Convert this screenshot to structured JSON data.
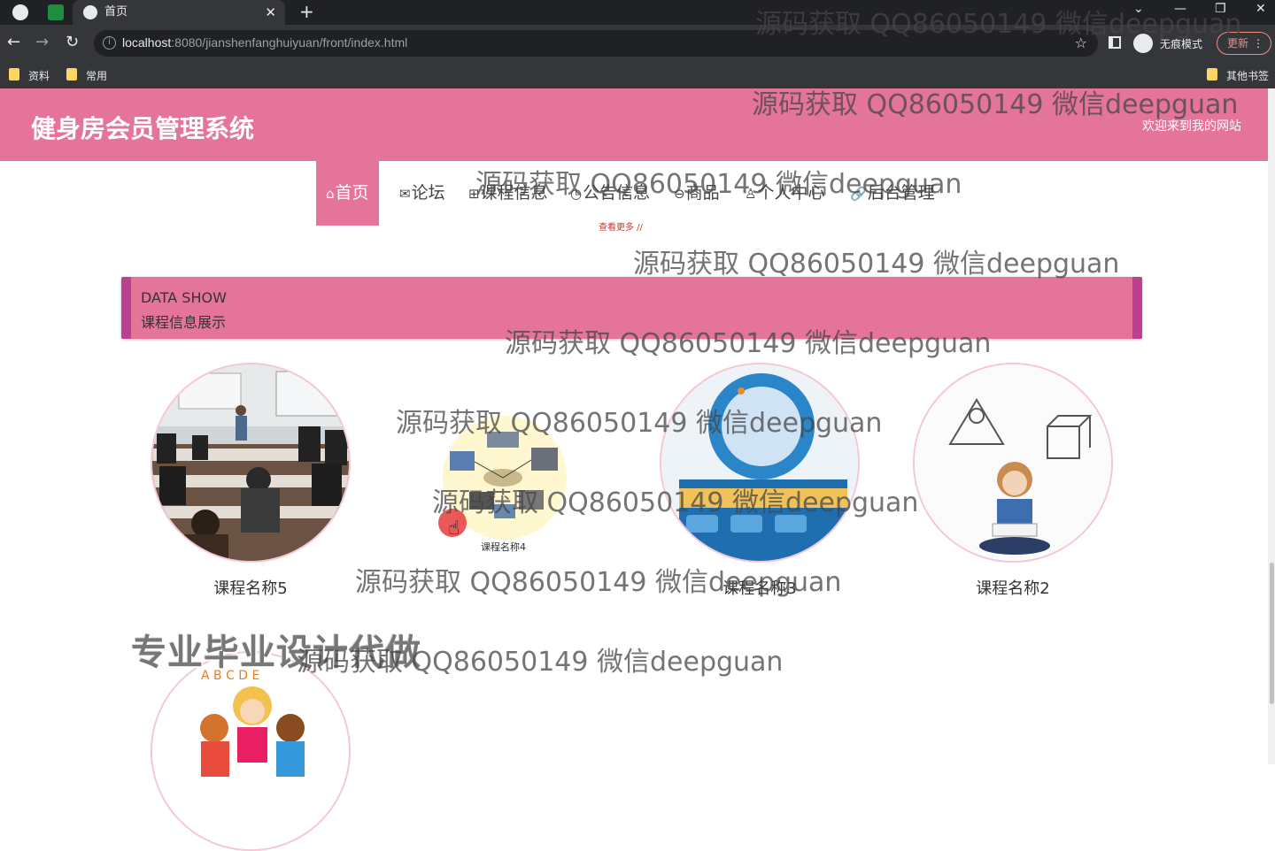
{
  "browser": {
    "tab_title": "首页",
    "url_host": "localhost",
    "url_path": ":8080/jianshenfanghuiyuan/front/index.html",
    "incognito_label": "无痕模式",
    "update_label": "更新",
    "bookmarks": [
      "资料",
      "常用"
    ],
    "other_bookmarks": "其他书签"
  },
  "site": {
    "title": "健身房会员管理系统",
    "welcome": "欢迎来到我的网站"
  },
  "nav": {
    "items": [
      {
        "icon": "⌂",
        "label": "首页"
      },
      {
        "icon": "✉",
        "label": "论坛"
      },
      {
        "icon": "⊞",
        "label": "课程信息"
      },
      {
        "icon": "◷",
        "label": "公告信息"
      },
      {
        "icon": "⊖",
        "label": "商品"
      },
      {
        "icon": "♙",
        "label": "个人中心"
      },
      {
        "icon": "🔗",
        "label": "后台管理"
      }
    ],
    "more_text": "查看更多 //"
  },
  "section": {
    "title_en": "DATA SHOW",
    "title_cn": "课程信息展示"
  },
  "courses": [
    {
      "name": "课程名称5"
    },
    {
      "name": "课程名称4"
    },
    {
      "name": "课程名称3"
    },
    {
      "name": "课程名称2"
    }
  ],
  "promo_text": "专业毕业设计代做",
  "watermark": "源码获取 QQ86050149 微信deepguan",
  "colors": {
    "accent": "#e4749a",
    "accent_dark": "#b9418f",
    "chrome_dark": "#202124"
  }
}
